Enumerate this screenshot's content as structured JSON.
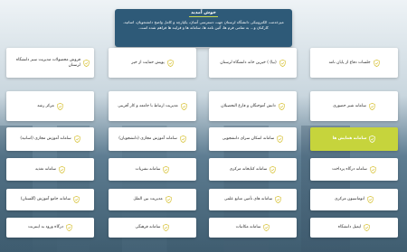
{
  "intro": {
    "title": "خوش آمدید",
    "text": "میزخدمت الکترونیکی دانشگاه لرستان جهت دسترسی آسان، یکپارچه و کامل واضح دانشجویان، اساتید، کارکنان و... به تمامی فرم ها، آئین نامه ها، سامانه ها و فرایند ها فراهم شده است."
  },
  "cards": [
    {
      "label": "جلسات دفاع از پایان نامه"
    },
    {
      "label": "(بیا) ) خیرین خانه دانشگاه لرستان"
    },
    {
      "label": "پویش حمایت از خیر"
    },
    {
      "label": "فروش محصولات مدیریت سبز دانشگاه لرستان"
    },
    {
      "label": "سامانه شیر حضوری"
    },
    {
      "label": "دانش آموختگان و فارغ التحصیلان"
    },
    {
      "label": "مدیریت ارتباط با جامعه و کار آفرینی"
    },
    {
      "label": "مرکز رشد"
    },
    {
      "label": "سامانه همایش ها"
    },
    {
      "label": "سامانه اسکان سرای دانشجویی"
    },
    {
      "label": "سامانه آموزش مجازی (دانشجویان)"
    },
    {
      "label": "سامانه آموزش مجازی (اساتید)"
    },
    {
      "label": "سامانه درگاه پرداخت"
    },
    {
      "label": "سامانه کتابخانه مرکزی"
    },
    {
      "label": "سامانه نشریات"
    },
    {
      "label": "سامانه تغذیه"
    },
    {
      "label": "اتوماسیون مرکزی"
    },
    {
      "label": "سامانه های تأمین منابع علمی"
    },
    {
      "label": "مدیریت بین الملل"
    },
    {
      "label": "سامانه جامع آموزش (گلستان)"
    },
    {
      "label": "ایمیل دانشگاه"
    },
    {
      "label": "سامانه مکاتبات"
    },
    {
      "label": "سامانه فرهنگی"
    },
    {
      "label": "درگاه ورود به اینترنت"
    }
  ],
  "colors": {
    "header": "#2e5a78",
    "accent": "#c6d43c",
    "icon": "#d8c33a"
  }
}
